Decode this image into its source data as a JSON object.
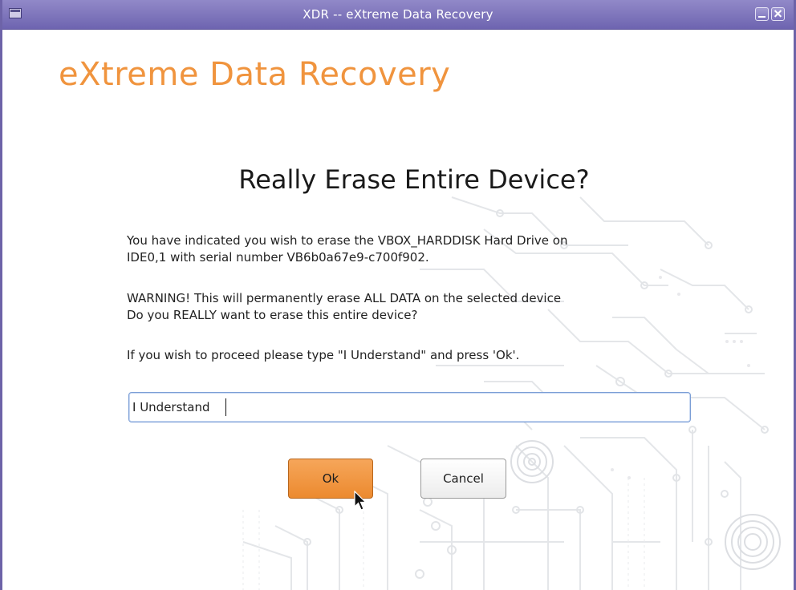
{
  "window": {
    "title": "XDR -- eXtreme Data Recovery"
  },
  "brand": {
    "name": "eXtreme Data Recovery",
    "color": "#f0943e"
  },
  "dialog": {
    "title": "Really Erase Entire Device?",
    "paragraph1": [
      "You have indicated you wish to erase the VBOX_HARDDISK Hard Drive on",
      "IDE0,1 with serial number VB6b0a67e9-c700f902."
    ],
    "paragraph2": [
      "WARNING!  This will permanently erase ALL DATA on the selected device",
      "Do you REALLY want to erase this entire device?"
    ],
    "paragraph3": [
      "If you wish to proceed please type \"I Understand\" and press 'Ok'."
    ],
    "confirm_input": {
      "value": "I Understand"
    },
    "ok_label": "Ok",
    "cancel_label": "Cancel"
  },
  "colors": {
    "titlebar": "#7a70bc",
    "ok_button": "#ec8a2f",
    "input_border": "#7b9ed6"
  },
  "icons": {
    "window_menu": "window-menu-icon",
    "minimize": "minimize-icon",
    "close": "close-icon",
    "pointer": "mouse-pointer-icon"
  }
}
